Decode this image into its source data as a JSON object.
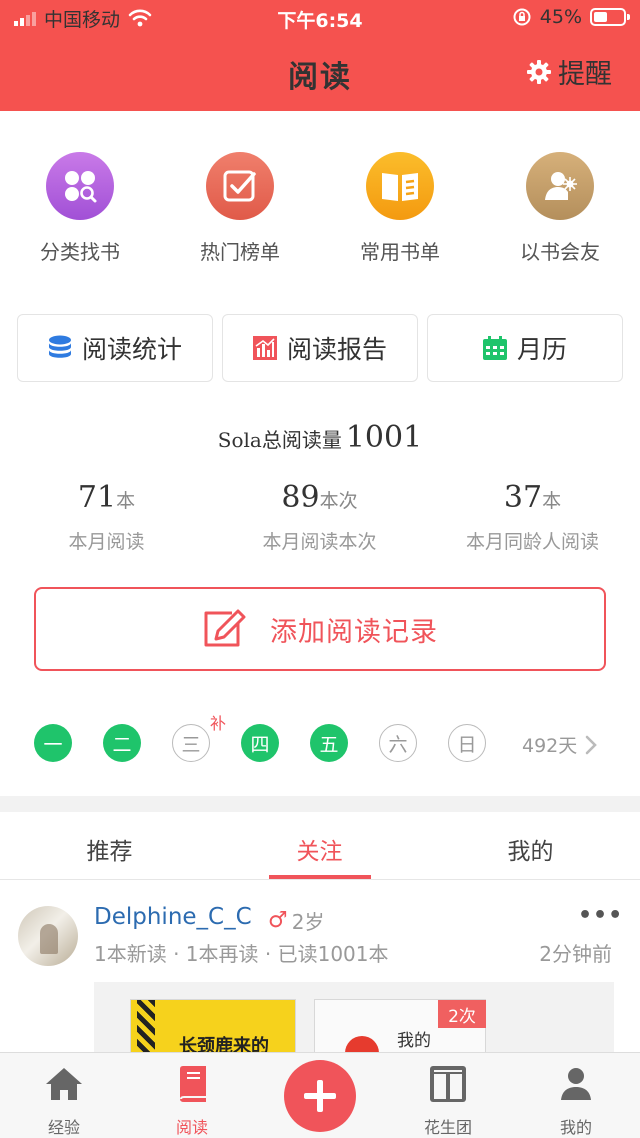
{
  "status_bar": {
    "carrier": "中国移动",
    "time": "下午6:54",
    "battery": "45%"
  },
  "header": {
    "title": "阅读",
    "remind_label": "提醒"
  },
  "entries": [
    {
      "label": "分类找书",
      "color": "#b864e0",
      "icon": "category-search-icon"
    },
    {
      "label": "热门榜单",
      "color": "#ea6c5a",
      "icon": "checklist-icon"
    },
    {
      "label": "常用书单",
      "color": "#f7a81a",
      "icon": "book-list-icon"
    },
    {
      "label": "以书会友",
      "color": "#c8a36c",
      "icon": "reader-friend-icon"
    }
  ],
  "tools": [
    {
      "label": "阅读统计",
      "icon": "database-icon",
      "color": "#2f7be0"
    },
    {
      "label": "阅读报告",
      "icon": "bar-chart-icon",
      "color": "#f0545a"
    },
    {
      "label": "月历",
      "icon": "calendar-icon",
      "color": "#1fc46b"
    }
  ],
  "summary": {
    "prefix": "Sola总阅读量",
    "total": "1001"
  },
  "stats": [
    {
      "value": "71",
      "unit": "本",
      "label": "本月阅读"
    },
    {
      "value": "89",
      "unit": "本次",
      "label": "本月阅读本次"
    },
    {
      "value": "37",
      "unit": "本",
      "label": "本月同龄人阅读"
    }
  ],
  "add_record_label": "添加阅读记录",
  "week": {
    "days": [
      {
        "label": "一",
        "done": true
      },
      {
        "label": "二",
        "done": true
      },
      {
        "label": "三",
        "done": false
      },
      {
        "label": "四",
        "done": true
      },
      {
        "label": "五",
        "done": true
      },
      {
        "label": "六",
        "done": false
      },
      {
        "label": "日",
        "done": false
      }
    ],
    "makeup_label": "补",
    "total_days": "492天"
  },
  "feed_tabs": [
    {
      "label": "推荐",
      "active": false
    },
    {
      "label": "关注",
      "active": true
    },
    {
      "label": "我的",
      "active": false
    }
  ],
  "post": {
    "username": "Delphine_C_C",
    "gender_symbol": "♂",
    "age": "2岁",
    "meta": "1本新读 · 1本再读 · 已读1001本",
    "time": "2分钟前",
    "more": "•••",
    "book1_title": "长颈鹿来的",
    "book2_title": "我的",
    "times_badge": "2次"
  },
  "bottom_nav": [
    {
      "label": "经验",
      "icon": "home-icon",
      "active": false
    },
    {
      "label": "阅读",
      "icon": "book-icon",
      "active": true
    },
    {
      "label": "花生团",
      "icon": "group-icon",
      "active": false
    },
    {
      "label": "我的",
      "icon": "person-icon",
      "active": false
    }
  ]
}
